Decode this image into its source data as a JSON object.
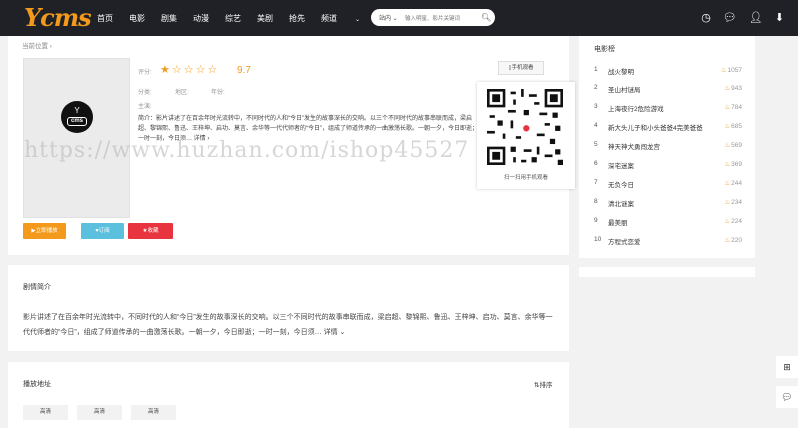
{
  "nav": {
    "logo": "Ycms",
    "menu": [
      "首页",
      "电影",
      "剧集",
      "动漫",
      "综艺",
      "美剧",
      "抢先",
      "频道"
    ],
    "search_select": "站内",
    "search_placeholder": "输入明星、影片关键词",
    "icons": [
      "history-icon",
      "message-icon",
      "user-icon",
      "download-icon"
    ]
  },
  "breadcrumb": "当前位置 ›",
  "movie": {
    "poster_logo_top": "Y",
    "poster_logo_bottom": "cms",
    "rating_label": "评分:",
    "rating_stars": 1,
    "rating_total": 5,
    "score": "9.7",
    "category_label": "分类:",
    "region_label": "地区:",
    "year_label": "年份:",
    "cast_label": "主演:",
    "intro": "简介：影片讲述了在百余年时光流转中，不同时代的人和“今日”发生的故事深长的交响。以三个不同时代的故事串联而成，梁启超、黎锦熙、鲁迅、王梓坤、启功、莫言、余华等一代代师者的“今日”，组成了师道传承的一曲激荡长歌。一朝一夕，今日即逝；一时一刻，今日须… 详情 ›",
    "buttons": {
      "play": "▶立即播放",
      "subscribe": "♥订阅",
      "favorite": "★收藏"
    },
    "mobile_btn": "手机观看",
    "qr_caption": "扫一扫用手机观看"
  },
  "synopsis": {
    "title": "剧情简介",
    "text": "影片讲述了在百余年时光流转中，不同时代的人和“今日”发生的故事深长的交响。以三个不同时代的故事串联而成，梁启超、黎锦熙、鲁迅、王梓坤、启功、莫言、余华等一代代师者的“今日”，组成了师道传承的一曲激荡长歌。一朝一夕，今日即逝；一时一刻，今日须… 详情 ⌄"
  },
  "play": {
    "title": "播放地址",
    "sort": "⇅排序",
    "items": [
      "高清",
      "高清",
      "高清"
    ]
  },
  "ranking": {
    "title": "电影榜",
    "items": [
      {
        "n": "1",
        "t": "战火黎明",
        "h": "1057"
      },
      {
        "n": "2",
        "t": "圣山村谜局",
        "h": "943"
      },
      {
        "n": "3",
        "t": "上海夜行2危险游戏",
        "h": "784"
      },
      {
        "n": "4",
        "t": "新大头儿子和小头爸爸4完美爸爸",
        "h": "685"
      },
      {
        "n": "5",
        "t": "神天神犬勇闯龙宫",
        "h": "569"
      },
      {
        "n": "6",
        "t": "深宅迷案",
        "h": "369"
      },
      {
        "n": "7",
        "t": "无负今日",
        "h": "244"
      },
      {
        "n": "8",
        "t": "清北谜案",
        "h": "234"
      },
      {
        "n": "9",
        "t": "最美丽",
        "h": "224"
      },
      {
        "n": "10",
        "t": "方程式恋爱",
        "h": "220"
      }
    ]
  },
  "watermark": "https://www.huzhan.com/ishop45527"
}
